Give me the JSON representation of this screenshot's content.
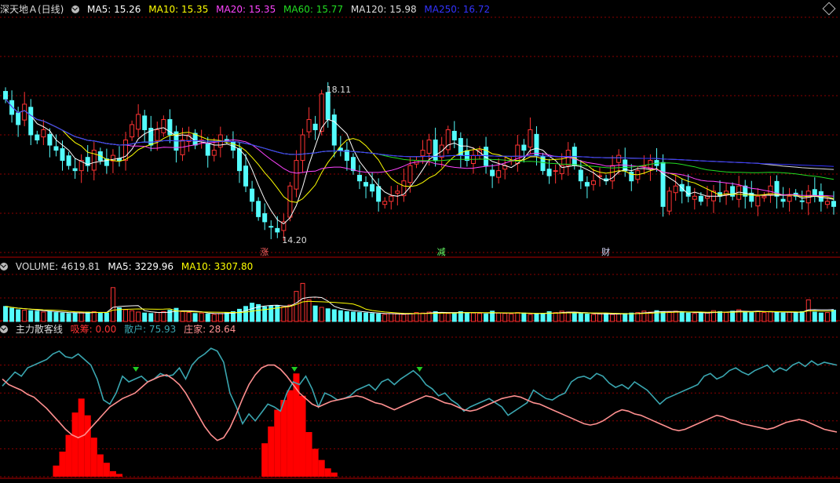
{
  "main_panel": {
    "title": "深天地Ａ(日线)",
    "indicators": [
      {
        "label": "MA5: 15.26",
        "color": "#ffffff"
      },
      {
        "label": "MA10: 15.35",
        "color": "#ffff00"
      },
      {
        "label": "MA20: 15.35",
        "color": "#ff44ff"
      },
      {
        "label": "MA60: 15.77",
        "color": "#22dd22"
      },
      {
        "label": "MA120: 15.98",
        "color": "#dddddd"
      },
      {
        "label": "MA250: 16.72",
        "color": "#3333ff"
      }
    ],
    "high_label": "18.11",
    "low_label": "14.20",
    "event_markers": [
      "涨",
      "减",
      "财"
    ]
  },
  "volume_panel": {
    "title": "VOLUME: 4619.81",
    "ma5": "MA5: 3229.96",
    "ma10": "MA10: 3307.80"
  },
  "indicator_panel": {
    "title": "主力散客线",
    "absorb": "吸筹: 0.00",
    "retail": "散户: 75.93",
    "dealer": "庄家: 28.64"
  },
  "colors": {
    "up": "#ff3333",
    "down": "#54fcfc",
    "grid": "#8b0000",
    "retail_line": "#3aa6b0",
    "dealer_line": "#ff9090",
    "absorb_fill": "#ff0000"
  },
  "chart_data": [
    {
      "type": "candlestick",
      "y_range": [
        13.9,
        18.5
      ],
      "closes": [
        16.9,
        16.6,
        16.4,
        16.8,
        16.2,
        16.1,
        16.3,
        16.0,
        15.9,
        15.7,
        15.6,
        15.5,
        15.7,
        15.6,
        15.9,
        15.7,
        15.6,
        15.8,
        15.7,
        16.1,
        16.4,
        16.6,
        16.3,
        16.0,
        16.3,
        16.5,
        16.2,
        15.9,
        16.1,
        16.2,
        16.0,
        16.1,
        15.8,
        15.9,
        16.2,
        16.1,
        15.9,
        15.5,
        15.2,
        14.9,
        14.6,
        14.5,
        14.4,
        14.3,
        14.5,
        15.2,
        15.7,
        16.2,
        16.5,
        16.3,
        17.0,
        16.5,
        16.0,
        15.9,
        15.7,
        15.5,
        15.3,
        15.2,
        15.1,
        14.9,
        14.9,
        15.0,
        15.1,
        15.3,
        15.6,
        15.7,
        15.9,
        16.1,
        15.7,
        16.0,
        16.3,
        16.1,
        15.8,
        15.7,
        15.8,
        15.9,
        15.6,
        15.4,
        15.5,
        15.6,
        15.7,
        16.0,
        15.9,
        16.3,
        15.8,
        15.5,
        15.4,
        15.5,
        15.6,
        15.9,
        15.6,
        15.3,
        15.2,
        15.3,
        15.4,
        15.3,
        15.6,
        15.8,
        15.5,
        15.3,
        15.5,
        15.6,
        15.7,
        15.6,
        14.8,
        15.1,
        15.2,
        15.1,
        15.0,
        15.0,
        14.9,
        15.0,
        15.1,
        15.0,
        15.1,
        15.0,
        15.2,
        15.0,
        14.9,
        15.0,
        15.0,
        15.2,
        15.0,
        14.9,
        15.0,
        15.0,
        14.9,
        15.1,
        15.0,
        14.9,
        14.9,
        14.8
      ]
    },
    {
      "type": "bar",
      "name": "volume",
      "y_range": [
        0,
        10000
      ],
      "values": [
        3200,
        2800,
        2500,
        2400,
        2300,
        2200,
        2000,
        2100,
        1900,
        1800,
        1700,
        1800,
        1900,
        2000,
        2100,
        1900,
        1800,
        7200,
        2900,
        2500,
        2300,
        2000,
        1800,
        1700,
        1900,
        2100,
        2400,
        2800,
        2100,
        1900,
        1700,
        1800,
        1600,
        1500,
        1700,
        1900,
        2100,
        2600,
        3200,
        3900,
        3600,
        3100,
        3300,
        3400,
        3100,
        3500,
        6400,
        8100,
        4600,
        3300,
        3000,
        2700,
        2500,
        2300,
        2100,
        2000,
        1900,
        1800,
        1700,
        1600,
        1500,
        1700,
        1600,
        1500,
        1700,
        1900,
        1800,
        2000,
        2100,
        1900,
        1700,
        1800,
        2100,
        1900,
        1800,
        1700,
        1600,
        2200,
        1800,
        1700,
        1600,
        1900,
        1800,
        1500,
        1600,
        1700,
        2100,
        1900,
        2200,
        2000,
        1800,
        1700,
        1600,
        1500,
        1600,
        1700,
        1500,
        1600,
        1700,
        1800,
        1900,
        2200,
        2000,
        2300,
        2100,
        2000,
        2200,
        1900,
        1800,
        1700,
        1900,
        1800,
        2300,
        2100,
        1900,
        2200,
        2500,
        2100,
        1900,
        2200,
        1900,
        2100,
        2000,
        1800,
        2000,
        1900,
        2100,
        4600,
        2000,
        1800,
        1900,
        2400
      ]
    },
    {
      "type": "line",
      "name": "主力散客线",
      "y_range": [
        0,
        100
      ],
      "retail": [
        65,
        70,
        75,
        72,
        78,
        80,
        82,
        84,
        88,
        90,
        86,
        85,
        88,
        84,
        80,
        70,
        55,
        52,
        60,
        72,
        68,
        70,
        72,
        68,
        70,
        74,
        72,
        73,
        78,
        70,
        80,
        85,
        88,
        92,
        90,
        82,
        60,
        50,
        38,
        45,
        40,
        46,
        52,
        50,
        47,
        60,
        68,
        66,
        72,
        63,
        50,
        60,
        58,
        55,
        56,
        58,
        62,
        64,
        66,
        62,
        68,
        70,
        66,
        70,
        73,
        76,
        72,
        66,
        63,
        58,
        60,
        55,
        52,
        47,
        50,
        52,
        54,
        56,
        53,
        50,
        44,
        47,
        50,
        53,
        62,
        59,
        56,
        55,
        58,
        60,
        68,
        71,
        72,
        70,
        74,
        72,
        67,
        64,
        66,
        63,
        68,
        65,
        62,
        57,
        52,
        56,
        58,
        60,
        62,
        64,
        66,
        72,
        74,
        70,
        72,
        76,
        78,
        75,
        73,
        76,
        78,
        80,
        75,
        78,
        76,
        80,
        82,
        79,
        83,
        80,
        82,
        81,
        80
      ],
      "dealer": [
        70,
        66,
        64,
        62,
        59,
        57,
        53,
        49,
        44,
        39,
        34,
        30,
        28,
        30,
        35,
        40,
        45,
        50,
        53,
        56,
        58,
        60,
        64,
        68,
        70,
        72,
        73,
        70,
        66,
        60,
        52,
        44,
        36,
        30,
        26,
        28,
        35,
        45,
        56,
        66,
        73,
        78,
        80,
        80,
        77,
        72,
        66,
        60,
        56,
        52,
        50,
        52,
        54,
        55,
        56,
        57,
        58,
        57,
        55,
        53,
        52,
        50,
        48,
        50,
        52,
        54,
        56,
        58,
        57,
        55,
        53,
        52,
        50,
        48,
        47,
        48,
        50,
        52,
        54,
        56,
        57,
        58,
        57,
        55,
        53,
        52,
        50,
        48,
        46,
        44,
        42,
        40,
        38,
        37,
        38,
        40,
        43,
        46,
        48,
        47,
        45,
        44,
        42,
        40,
        38,
        36,
        34,
        33,
        34,
        36,
        38,
        40,
        42,
        44,
        43,
        41,
        40,
        38,
        37,
        36,
        35,
        34,
        35,
        37,
        39,
        40,
        41,
        40,
        38,
        36,
        34,
        33,
        32
      ],
      "absorb_bars": [
        0,
        0,
        0,
        0,
        0,
        0,
        0,
        0,
        8,
        18,
        30,
        46,
        56,
        44,
        28,
        16,
        10,
        4,
        2,
        0,
        0,
        0,
        0,
        0,
        0,
        0,
        0,
        0,
        0,
        0,
        0,
        0,
        0,
        0,
        0,
        0,
        0,
        0,
        0,
        0,
        0,
        24,
        36,
        48,
        55,
        62,
        74,
        58,
        32,
        20,
        12,
        6,
        3,
        0,
        0,
        0,
        0,
        0,
        0,
        0,
        0,
        0,
        0,
        0,
        0,
        0,
        0,
        0,
        0,
        0,
        0,
        0,
        0,
        0,
        0,
        0,
        0,
        0,
        0,
        0,
        0,
        0,
        0,
        0,
        0,
        0,
        0,
        0,
        0,
        0,
        0,
        0,
        0,
        0,
        0,
        0,
        0,
        0,
        0,
        0,
        0,
        0,
        0,
        0,
        0,
        0,
        0,
        0,
        0,
        0,
        0,
        0,
        0,
        0,
        0,
        0,
        0,
        0,
        0,
        0,
        0,
        0,
        0,
        0,
        0,
        0,
        0,
        0,
        0,
        0,
        0,
        0,
        0
      ]
    }
  ]
}
